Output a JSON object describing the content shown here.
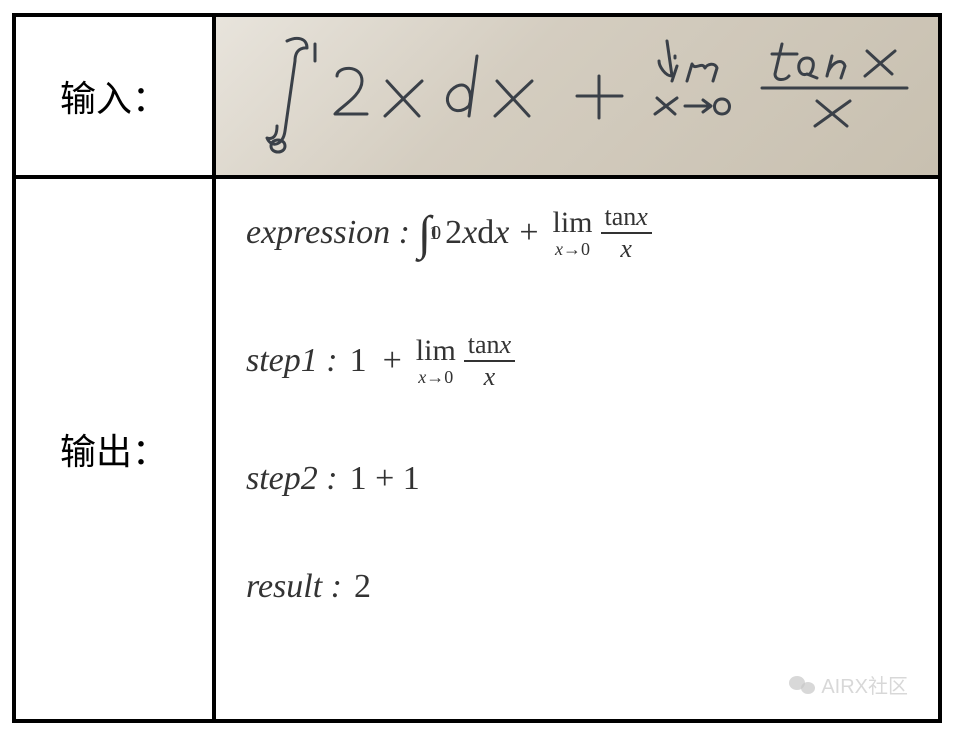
{
  "labels": {
    "input": "输入：",
    "output": "输出："
  },
  "handwritten": {
    "expression": "\\int_0^1 2x\\,dx + \\lim_{x\\to 0} \\frac{\\tan x}{x}"
  },
  "output": {
    "expression_label": "expression :",
    "expression": {
      "integral_lower": "0",
      "integral_upper": "1",
      "integrand": "2x",
      "dx": "dx",
      "plus": "+",
      "lim_label": "lim",
      "lim_sub_var": "x",
      "lim_sub_arrow": "→",
      "lim_sub_to": "0",
      "frac_num_fn": "tan",
      "frac_num_var": "x",
      "frac_den": "x"
    },
    "step1_label": "step1 :",
    "step1": {
      "one": "1",
      "plus": "+",
      "lim_label": "lim",
      "lim_sub_var": "x",
      "lim_sub_arrow": "→",
      "lim_sub_to": "0",
      "frac_num_fn": "tan",
      "frac_num_var": "x",
      "frac_den": "x"
    },
    "step2_label": "step2 :",
    "step2_value": "1 + 1",
    "result_label": "result :",
    "result_value": "2"
  },
  "watermark": {
    "text": "AIRX社区"
  }
}
